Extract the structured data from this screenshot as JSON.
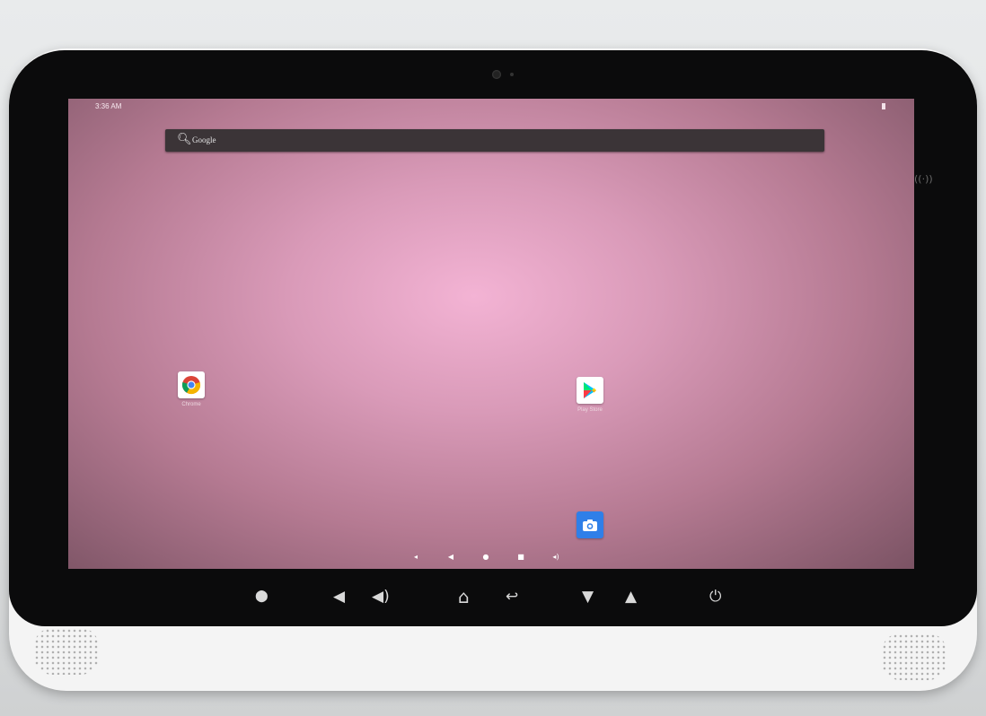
{
  "status_bar": {
    "time": "3:36 AM"
  },
  "search": {
    "label": "Google",
    "icon": "search-icon"
  },
  "apps": [
    {
      "name": "Chrome",
      "label": "Chrome",
      "icon": "chrome-icon"
    },
    {
      "name": "Play Store",
      "label": "Play Store",
      "icon": "play-store-icon"
    },
    {
      "name": "Camera",
      "label": "",
      "icon": "camera-icon"
    }
  ],
  "nav_bar": {
    "volume_down": "◂",
    "back": "◀",
    "home": "●",
    "recents": "■",
    "volume_up": "◂)"
  },
  "hardware_buttons": {
    "location": "⬤",
    "volume_down": "◀",
    "volume_up": "◀)",
    "home": "⌂",
    "back": "↩",
    "brightness_down": "▼",
    "brightness_up": "▲",
    "power": "⏻"
  },
  "colors": {
    "wallpaper_center": "#f3b3d4",
    "wallpaper_edge": "#7b5364",
    "bezel": "#0b0b0c",
    "device_body": "#f4f4f4",
    "camera_app": "#2f7fe8"
  }
}
